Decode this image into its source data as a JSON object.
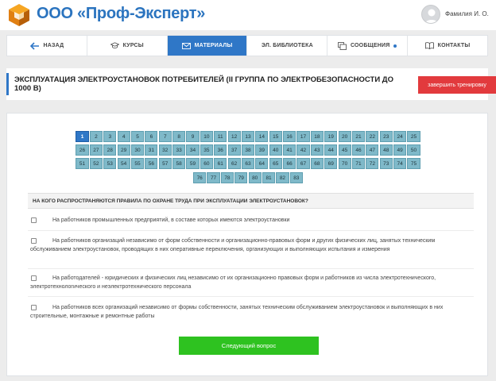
{
  "header": {
    "brand": "ООО «Проф-Эксперт»",
    "user_name": "Фамилия И. О."
  },
  "nav": [
    {
      "label": "НАЗАД",
      "icon": "arrow-left-icon",
      "active": false
    },
    {
      "label": "КУРСЫ",
      "icon": "graduation-cap-icon",
      "active": false
    },
    {
      "label": "МАТЕРИАЛЫ",
      "icon": "envelope-icon",
      "active": true
    },
    {
      "label": "ЭЛ. БИБЛИОТЕКА",
      "icon": "",
      "active": false
    },
    {
      "label": "СООБЩЕНИЯ",
      "icon": "messages-icon",
      "active": false,
      "has_indicator": true
    },
    {
      "label": "КОНТАКТЫ",
      "icon": "book-icon",
      "active": false
    }
  ],
  "page": {
    "title": "ЭКСПЛУАТАЦИЯ ЭЛЕКТРОУСТАНОВОК ПОТРЕБИТЕЛЕЙ (II ГРУППА ПО ЭЛЕКТРОБЕЗОПАСНОСТИ ДО 1000 В)",
    "finish_label": "завершить тренировку"
  },
  "questions": {
    "total": 83,
    "current": 1,
    "rows": [
      [
        1,
        2,
        3,
        4,
        5,
        6,
        7,
        8,
        9,
        10,
        11,
        12,
        13,
        14,
        15,
        16,
        17,
        18,
        19,
        20,
        21,
        22,
        23,
        24,
        25
      ],
      [
        26,
        27,
        28,
        29,
        30,
        31,
        32,
        33,
        34,
        35,
        36,
        37,
        38,
        39,
        40,
        41,
        42,
        43,
        44,
        45,
        46,
        47,
        48,
        49,
        50
      ],
      [
        51,
        52,
        53,
        54,
        55,
        56,
        57,
        58,
        59,
        60,
        61,
        62,
        63,
        64,
        65,
        66,
        67,
        68,
        69,
        70,
        71,
        72,
        73,
        74,
        75
      ],
      [
        76,
        77,
        78,
        79,
        80,
        81,
        82,
        83
      ]
    ]
  },
  "question": {
    "text": "НА КОГО РАСПРОСТРАНЯЮТСЯ ПРАВИЛА ПО ОХРАНЕ ТРУДА ПРИ ЭКСПЛУАТАЦИИ ЭЛЕКТРОУСТАНОВОК?",
    "answers": [
      "На работников промышленных предприятий, в составе которых имеются электроустановки",
      "На работников организаций независимо от форм собственности и организационно-правовых форм и других физических лиц, занятых техническим обслуживанием электроустановок, проводящих в них оперативные переключения, организующих и выполняющих испытания и измерения",
      "На работодателей - юридических и физических лиц независимо от их организационно правовых форм и работников из числа электротехнического, электротехнологического и неэлектротехнического персонала",
      "На работников всех организаций независимо от формы собственности, занятых техническим обслуживанием электроустановок и выполняющих в них строительные, монтажные и ремонтные работы"
    ]
  },
  "next_label": "Следующий вопрос"
}
